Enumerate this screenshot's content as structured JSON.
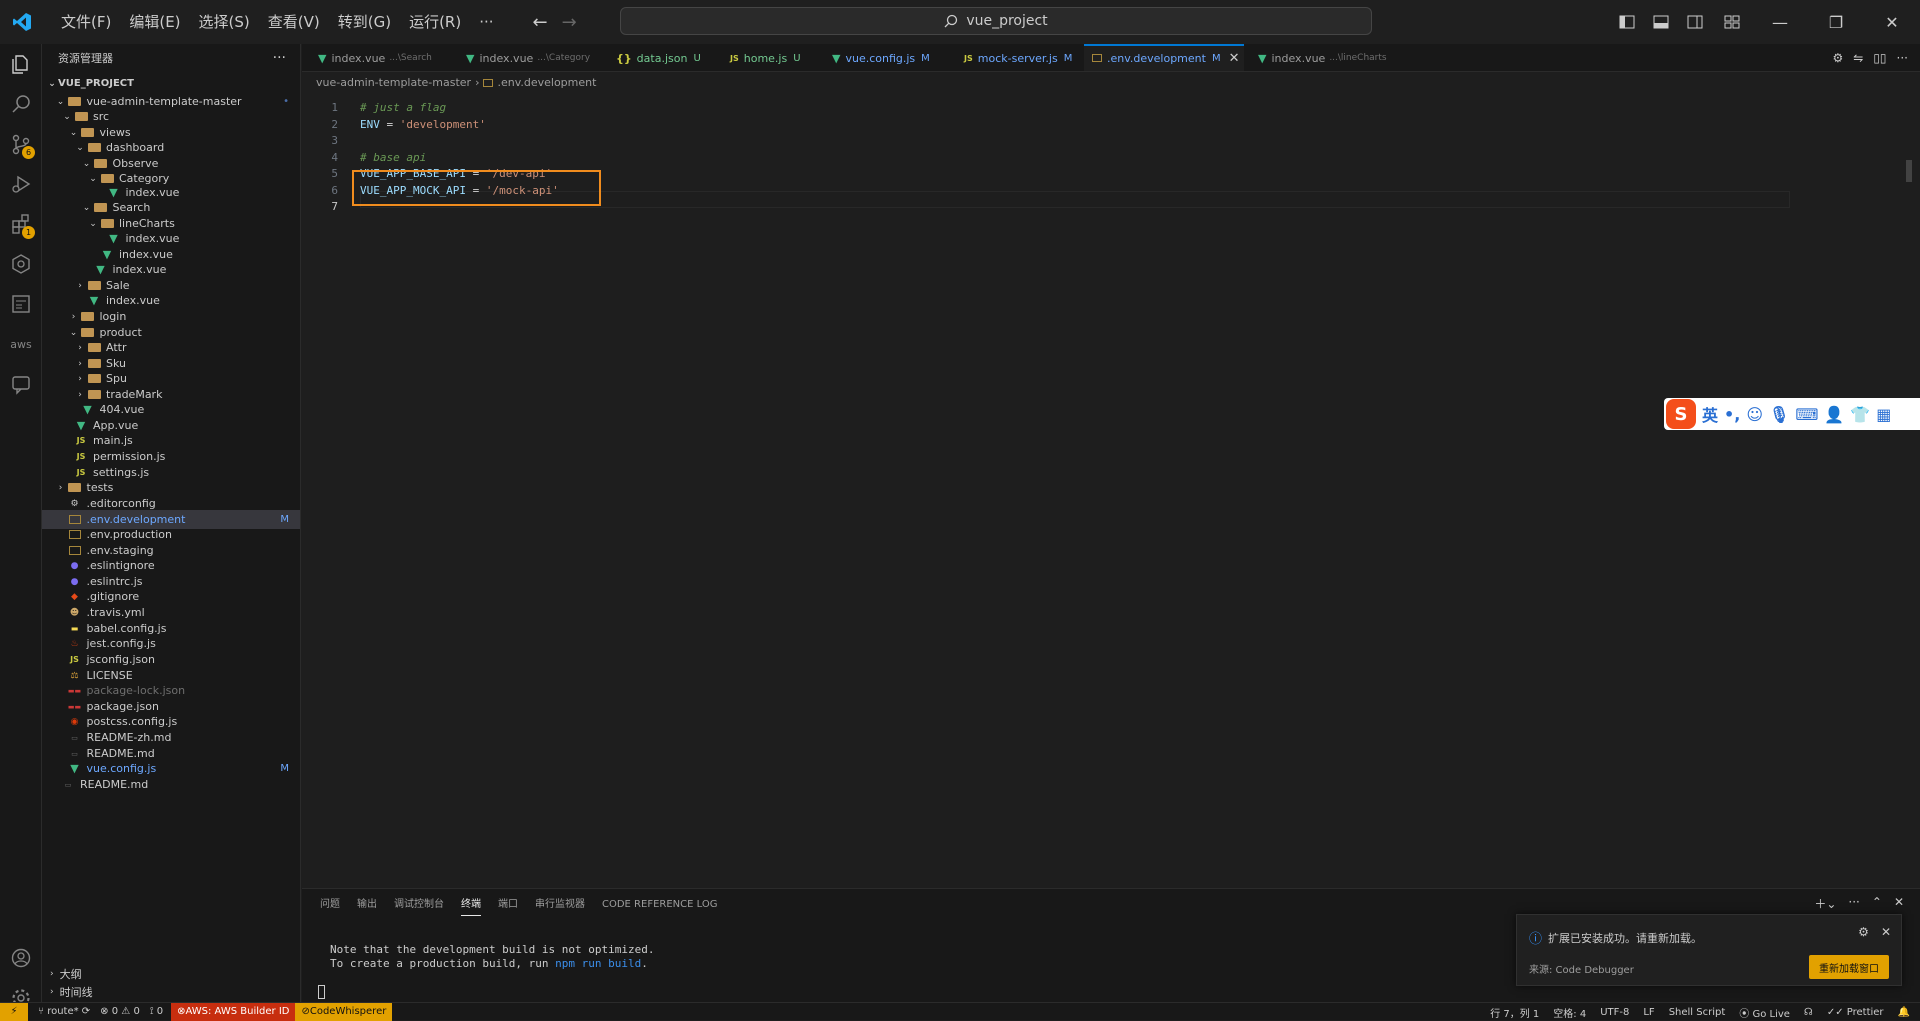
{
  "title_bar": {
    "menus": [
      "文件(F)",
      "编辑(E)",
      "选择(S)",
      "查看(V)",
      "转到(G)",
      "运行(R)",
      "···"
    ],
    "search_text": "vue_project"
  },
  "activity_bar": {
    "source_control_badge": "6",
    "extensions_badge": "1",
    "aws_label": "aws"
  },
  "sidebar": {
    "title": "资源管理器",
    "more": "···",
    "project": "VUE_PROJECT",
    "tree": [
      {
        "label": "vue-admin-template-master",
        "icon": "folder",
        "status": "•"
      },
      {
        "label": "src",
        "icon": "folder"
      },
      {
        "label": "views",
        "icon": "folder"
      },
      {
        "label": "dashboard",
        "icon": "folder"
      },
      {
        "label": "Observe",
        "icon": "folder"
      },
      {
        "label": "Category",
        "icon": "folder"
      },
      {
        "label": "index.vue",
        "icon": "vue"
      },
      {
        "label": "Search",
        "icon": "folder"
      },
      {
        "label": "lineCharts",
        "icon": "folder"
      },
      {
        "label": "index.vue",
        "icon": "vue"
      },
      {
        "label": "index.vue",
        "icon": "vue"
      },
      {
        "label": "index.vue",
        "icon": "vue"
      },
      {
        "label": "Sale",
        "icon": "folder"
      },
      {
        "label": "index.vue",
        "icon": "vue"
      },
      {
        "label": "login",
        "icon": "folder"
      },
      {
        "label": "product",
        "icon": "folder"
      },
      {
        "label": "Attr",
        "icon": "folder"
      },
      {
        "label": "Sku",
        "icon": "folder"
      },
      {
        "label": "Spu",
        "icon": "folder"
      },
      {
        "label": "tradeMark",
        "icon": "folder"
      },
      {
        "label": "404.vue",
        "icon": "vue"
      },
      {
        "label": "App.vue",
        "icon": "vue"
      },
      {
        "label": "main.js",
        "icon": "js"
      },
      {
        "label": "permission.js",
        "icon": "js"
      },
      {
        "label": "settings.js",
        "icon": "js"
      },
      {
        "label": "tests",
        "icon": "folder"
      },
      {
        "label": ".editorconfig",
        "icon": "gear"
      },
      {
        "label": ".env.development",
        "icon": "env",
        "status": "M"
      },
      {
        "label": ".env.production",
        "icon": "env"
      },
      {
        "label": ".env.staging",
        "icon": "env"
      },
      {
        "label": ".eslintignore",
        "icon": "eslint"
      },
      {
        "label": ".eslintrc.js",
        "icon": "eslint"
      },
      {
        "label": ".gitignore",
        "icon": "git"
      },
      {
        "label": ".travis.yml",
        "icon": "travis"
      },
      {
        "label": "babel.config.js",
        "icon": "babel"
      },
      {
        "label": "jest.config.js",
        "icon": "jest"
      },
      {
        "label": "jsconfig.json",
        "icon": "js"
      },
      {
        "label": "LICENSE",
        "icon": "license"
      },
      {
        "label": "package-lock.json",
        "icon": "npm"
      },
      {
        "label": "package.json",
        "icon": "npm"
      },
      {
        "label": "postcss.config.js",
        "icon": "postcss"
      },
      {
        "label": "README-zh.md",
        "icon": "md"
      },
      {
        "label": "README.md",
        "icon": "md"
      },
      {
        "label": "vue.config.js",
        "icon": "vue",
        "status": "M"
      },
      {
        "label": "README.md",
        "icon": "md"
      }
    ],
    "outline": "大纲",
    "timeline": "时间线"
  },
  "tabs": [
    {
      "label": "index.vue",
      "desc": "...\\Search",
      "icon": "vue"
    },
    {
      "label": "index.vue",
      "desc": "...\\Category",
      "icon": "vue"
    },
    {
      "label": "data.json",
      "status": "U",
      "icon": "json"
    },
    {
      "label": "home.js",
      "status": "U",
      "icon": "js"
    },
    {
      "label": "vue.config.js",
      "status": "M",
      "icon": "vue"
    },
    {
      "label": "mock-server.js",
      "status": "M",
      "icon": "js"
    },
    {
      "label": ".env.development",
      "status": "M",
      "icon": "env",
      "close": "✕"
    },
    {
      "label": "index.vue",
      "desc": "...\\lineCharts",
      "icon": "vue"
    }
  ],
  "breadcrumb": {
    "folder": "vue-admin-template-master",
    "file": ".env.development"
  },
  "editor": {
    "lines": [
      {
        "num": "1",
        "comment": "# just a flag"
      },
      {
        "num": "2",
        "key": "ENV",
        "op": " = ",
        "val": "'development'"
      },
      {
        "num": "3"
      },
      {
        "num": "4",
        "comment": "# base api"
      },
      {
        "num": "5",
        "key": "VUE_APP_BASE_API",
        "op": " = ",
        "val": "'/dev-api'"
      },
      {
        "num": "6",
        "key": "VUE_APP_MOCK_API",
        "op": " = ",
        "val": "'/mock-api'"
      },
      {
        "num": "7"
      }
    ]
  },
  "panel": {
    "tabs": [
      "问题",
      "输出",
      "调试控制台",
      "终端",
      "端口",
      "串行监视器",
      "CODE REFERENCE LOG"
    ],
    "terminal_line1": "Note that the development build is not optimized.",
    "terminal_line2_a": "To create a production build, run ",
    "terminal_line2_b": "npm run build",
    "terminal_line2_c": "."
  },
  "notification": {
    "message": "扩展已安装成功。请重新加载。",
    "source": "来源: Code Debugger",
    "button": "重新加载窗口"
  },
  "ime": {
    "logo": "S",
    "lang": "英"
  },
  "status_bar": {
    "branch": "route*",
    "errors": "0",
    "warnings": "0",
    "ports": "0",
    "aws": "AWS: AWS Builder ID",
    "codewhisperer": "CodeWhisperer",
    "position": "行 7，列 1",
    "spaces": "空格: 4",
    "encoding": "UTF-8",
    "eol": "LF",
    "language": "Shell Script",
    "golive": "Go Live",
    "prettier": "Prettier"
  },
  "colors": {
    "accent": "#0078d4",
    "highlight_box": "#f08c1e",
    "notify_button": "#e2a100",
    "aws_status": "#c72e0f"
  }
}
